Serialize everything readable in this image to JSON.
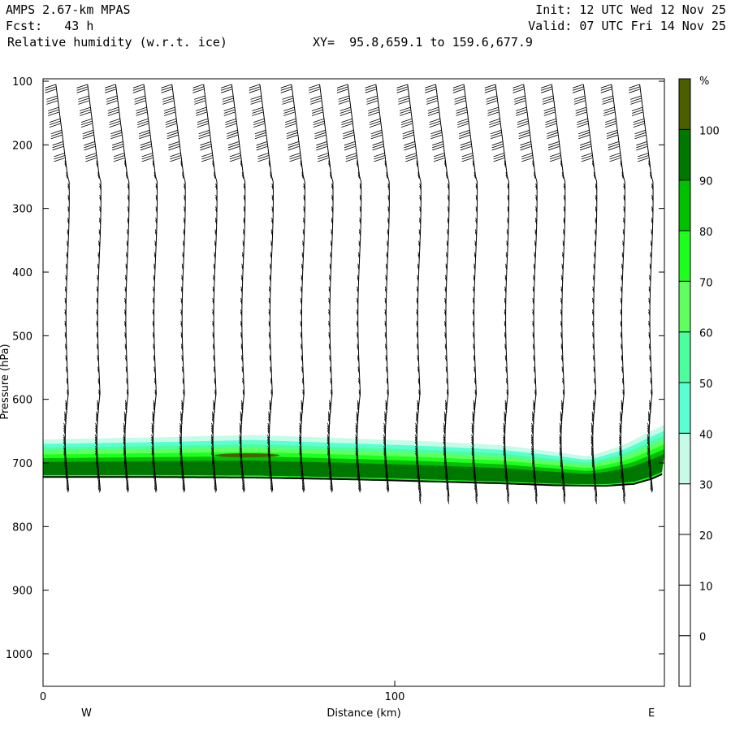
{
  "header": {
    "model": "AMPS 2.67-km MPAS",
    "fcst": "Fcst:   43 h",
    "field": "Relative humidity (w.r.t. ice)",
    "xy": "XY=  95.8,659.1 to 159.6,677.9",
    "init": "Init: 12 UTC Wed 12 Nov 25",
    "valid": "Valid: 07 UTC Fri 14 Nov 25"
  },
  "chart_data": {
    "type": "heatmap",
    "title": "Relative humidity (w.r.t. ice)",
    "xlabel": "Distance (km)",
    "ylabel": "Pressure (hPa)",
    "xlim": [
      0,
      176.7
    ],
    "ylim": [
      1051,
      96
    ],
    "x_ticks": [
      0,
      100
    ],
    "x_tick_labels": [
      "0",
      "100"
    ],
    "y_ticks": [
      100,
      200,
      300,
      400,
      500,
      600,
      700,
      800,
      900,
      1000
    ],
    "y_tick_labels": [
      "100",
      "200",
      "300",
      "400",
      "500",
      "600",
      "700",
      "800",
      "900",
      "1000"
    ],
    "west_label": "W",
    "east_label": "E",
    "colorbar": {
      "unit": "%",
      "levels": [
        -10,
        0,
        10,
        20,
        30,
        40,
        50,
        60,
        70,
        80,
        90,
        100,
        110
      ],
      "labels": [
        "0",
        "10",
        "20",
        "30",
        "40",
        "50",
        "60",
        "70",
        "80",
        "90",
        "100"
      ],
      "label_values": [
        0,
        10,
        20,
        30,
        40,
        50,
        60,
        70,
        80,
        90,
        100
      ],
      "colors": [
        "#ffffff",
        "#ffffff",
        "#ffffff",
        "#ffffff",
        "#c8fae8",
        "#5affd2",
        "#4cff9c",
        "#60ff60",
        "#1eff1e",
        "#00c000",
        "#007800",
        "#4b5f00"
      ]
    },
    "surface_pressure": {
      "x": [
        0,
        30,
        60,
        90,
        110,
        130,
        145,
        160,
        168,
        173,
        176.7
      ],
      "p": [
        722,
        722,
        723,
        726,
        729,
        732,
        735,
        736,
        733,
        725,
        716
      ]
    },
    "moist_layer_top_30pct": {
      "x": [
        0,
        30,
        60,
        90,
        110,
        130,
        145,
        155,
        165,
        172,
        176.7
      ],
      "p": [
        663,
        660,
        656,
        662,
        666,
        672,
        682,
        690,
        672,
        652,
        640
      ]
    },
    "wind_columns_km": [
      7,
      16,
      24,
      32,
      40,
      49,
      57,
      65,
      74,
      82,
      90,
      98,
      107,
      115,
      123,
      132,
      140,
      148,
      157,
      165,
      173
    ]
  }
}
